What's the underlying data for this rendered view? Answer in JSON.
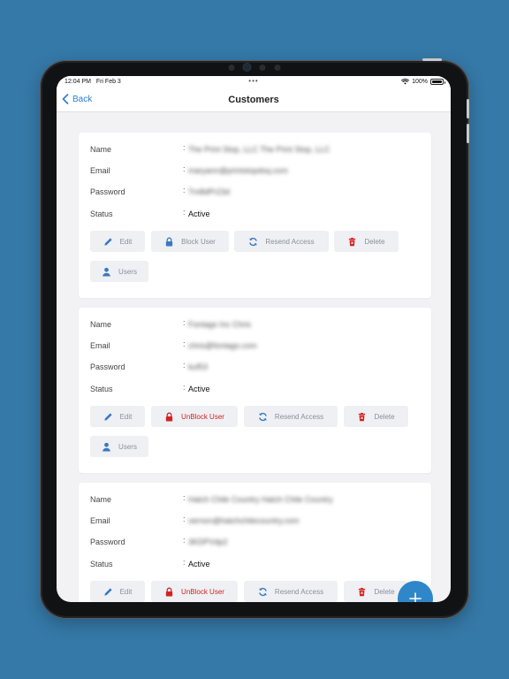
{
  "statusbar": {
    "time": "12:04 PM",
    "date": "Fri Feb 3",
    "dots": "•••",
    "battery": "100%"
  },
  "nav": {
    "back_label": "Back",
    "title": "Customers"
  },
  "labels": {
    "name": "Name",
    "email": "Email",
    "password": "Password",
    "status": "Status",
    "colon": ":"
  },
  "buttons": {
    "edit": "Edit",
    "block_user": "Block User",
    "unblock_user": "UnBlock User",
    "resend_access": "Resend Access",
    "delete": "Delete",
    "users": "Users"
  },
  "customers": [
    {
      "name": "The Print Stop, LLC The Print Stop, LLC",
      "email": "maryann@printstopdsq.com",
      "password": "Tm8dPr23d",
      "status": "Active"
    },
    {
      "name": "Fontago Inc Chris",
      "email": "chris@fontago.com",
      "password": "kuf53",
      "status": "Active"
    },
    {
      "name": "Hatch Chile Country Hatch Chile Country",
      "email": "vernon@hatchchilecountry.com",
      "password": "3KDPVdp2",
      "status": "Active"
    }
  ],
  "colors": {
    "background": "#3579a8",
    "accent": "#2b7cd3",
    "danger": "#d32222",
    "fab": "#2f86c8"
  },
  "icons": [
    "back-chevron-icon",
    "wifi-icon",
    "battery-icon",
    "pencil-icon",
    "lock-icon",
    "refresh-icon",
    "trash-icon",
    "user-icon",
    "plus-icon"
  ]
}
